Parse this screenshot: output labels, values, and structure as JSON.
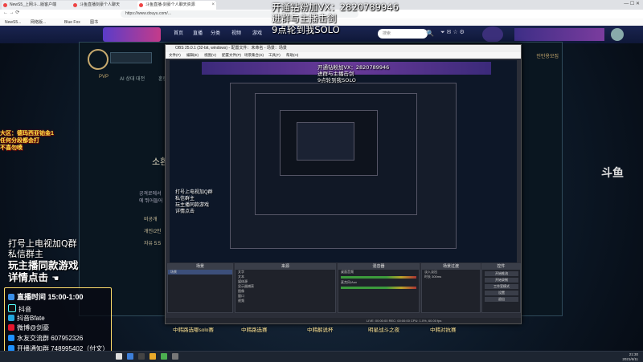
{
  "browser": {
    "tabs": [
      {
        "label": "NewS5_上网斗...版客户端"
      },
      {
        "label": "斗鱼直播剑豪个人聊天"
      },
      {
        "label": "斗鱼直播-剑豪个人聊天资源"
      }
    ],
    "url": "https://www.douyu.com/...",
    "bookmarks": [
      "NewS5...",
      "网络版...",
      "Blue Fox",
      "图书"
    ]
  },
  "site_nav": {
    "items": [
      "首页",
      "直播",
      "分类",
      "视频",
      "游戏"
    ],
    "search_placeholder": "搜索"
  },
  "stream_overlays": {
    "top_text": [
      "开通钻粉加VX：2820789946",
      "进群与主播击剑",
      "9点轮到我SOLO"
    ],
    "inner_top_text": [
      "开通钻粉加VX：2820789946",
      "进群与主播击剑",
      "9点轮到我SOLO"
    ],
    "left_yellow": [
      "大区：德玛西亚铂金1",
      "任何分段都会打",
      "不喜勿喷"
    ],
    "left_big": [
      "打号上电视加Q群",
      "私信群主",
      "玩主播同款游戏",
      "详情点击"
    ],
    "inner_left": [
      "打号上电视加Q群",
      "私信群主",
      "玩主播同款游戏",
      "详情点击"
    ],
    "info_panel": [
      {
        "label": "直播时间 15:00-1:00",
        "icon": "clock-icon",
        "color": "#3a8ee6"
      },
      {
        "label": "抖音",
        "icon": "tiktok-icon",
        "color": "#111111"
      },
      {
        "label": "抖音Bfate",
        "icon": "bilibili-icon",
        "color": "#23a7de"
      },
      {
        "label": "微博@剑豪",
        "icon": "weibo-icon",
        "color": "#e6162d"
      },
      {
        "label": "水友交流群 607952326",
        "icon": "qq-icon",
        "color": "#1e90ff"
      },
      {
        "label": "开播通知群 748995402（付文）",
        "icon": "qq-icon",
        "color": "#1e90ff"
      }
    ]
  },
  "lol_client": {
    "tabs": [
      "PVP",
      "AI 상대 대전",
      "훈련"
    ],
    "side_text": [
      "소환",
      "공격로에서",
      "에 뛰어들어",
      "비공개",
      "개인/2인",
      "자유 5:5"
    ],
    "right_label": "인민용모집"
  },
  "obs": {
    "title": "OBS 25.0.1 (32-bit, windows) - 配置文件：未命名 - 场景：场景",
    "menu": [
      "文件(F)",
      "编辑(E)",
      "视图(V)",
      "配置文件(P)",
      "场景集合(S)",
      "工具(T)",
      "帮助(H)"
    ],
    "docks": [
      {
        "title": "场景",
        "items": [
          "场景"
        ]
      },
      {
        "title": "来源",
        "items": [
          "文字",
          "文本",
          "媒体源",
          "显示器捕获",
          "图像",
          "窗口",
          "视频"
        ]
      },
      {
        "title": "混音器",
        "items": [
          "桌面音频",
          "麦克风/Aux"
        ]
      },
      {
        "title": "场景过渡",
        "items": [
          "淡入淡出",
          "时长 300ms"
        ]
      },
      {
        "title": "控件",
        "items": [
          "开始推流",
          "开始录制",
          "工作室模式",
          "设置",
          "退出"
        ]
      }
    ],
    "status": "LIVE: 00:00:00   REC: 00:00:00   CPU: 1.0%, 60.00 fps"
  },
  "bottom_banner": [
    "中韩路选哪solo赛",
    "中韩路选赛",
    "中韩解说杯",
    "明星战斗之夜",
    "中韩对抗赛"
  ],
  "right_logo": "斗鱼",
  "taskbar": {
    "time": "21:30",
    "date": "2021/6/11"
  }
}
